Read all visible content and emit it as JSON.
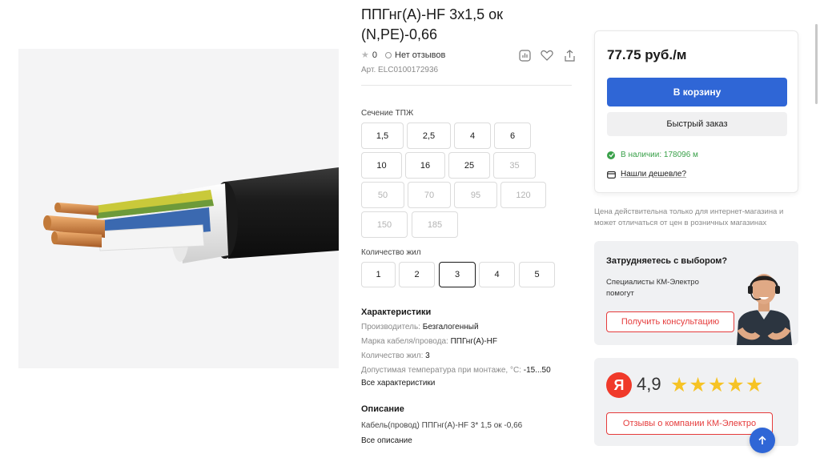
{
  "product": {
    "title": "ППГнг(A)-HF 3х1,5 ок (N,PE)-0,66",
    "rating": "0",
    "reviews": "Нет отзывов",
    "article": "Арт. ELC0100172936"
  },
  "section_group": {
    "label": "Сечение ТПЖ",
    "options": [
      "1,5",
      "2,5",
      "4",
      "6",
      "10",
      "16",
      "25",
      "35",
      "50",
      "70",
      "95",
      "120",
      "150",
      "185"
    ]
  },
  "cores_group": {
    "label": "Количество жил",
    "options": [
      "1",
      "2",
      "3",
      "4",
      "5"
    ],
    "selected": "3"
  },
  "characteristics": {
    "title": "Характеристики",
    "rows": [
      {
        "label": "Производитель:",
        "value": "Безгалогенный"
      },
      {
        "label": "Марка кабеля/провода:",
        "value": "ППГнг(А)-HF"
      },
      {
        "label": "Количество жил:",
        "value": "3"
      },
      {
        "label": "Допустимая температура при монтаже, °С:",
        "value": "-15...50"
      }
    ],
    "all_link": "Все характеристики"
  },
  "description": {
    "title": "Описание",
    "text": "Кабель(провод) ППГнг(А)-HF 3*  1,5 ок -0,66",
    "all_link": "Все описание"
  },
  "buy": {
    "price": "77.75 руб./м",
    "cart_label": "В корзину",
    "quick_label": "Быстрый заказ",
    "stock": "В наличии: 178096 м",
    "cheaper": "Нашли дешевле?",
    "note": "Цена действительна только для интернет-магазина и может отличаться от цен в розничных магазинах"
  },
  "help": {
    "title": "Затрудняетесь с выбором?",
    "text": "Специалисты КМ-Электро помогут",
    "button": "Получить консультацию"
  },
  "yandex": {
    "logo": "Я",
    "score": "4,9",
    "stars": 5,
    "button": "Отзывы о компании КМ-Электро"
  },
  "colors": {
    "accent": "#2f66d6",
    "danger": "#e53b3b",
    "success": "#3aa14a",
    "star": "#f6c325"
  }
}
